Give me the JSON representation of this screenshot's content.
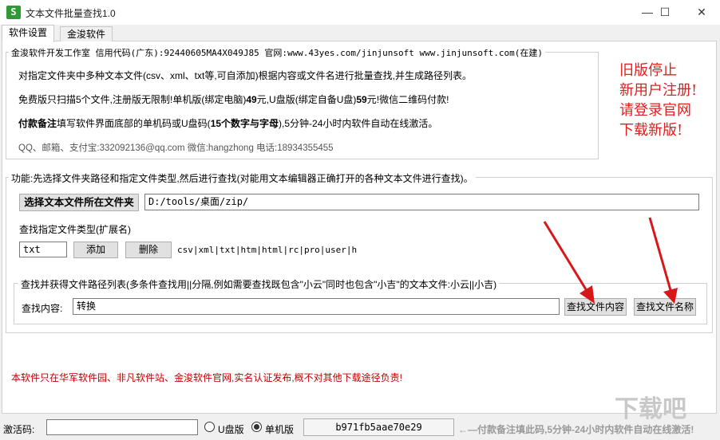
{
  "window": {
    "title": "文本文件批量查找1.0",
    "icon_glyph": "S",
    "minimize_glyph": "—",
    "maximize_glyph": "☐",
    "close_glyph": "✕"
  },
  "tabs": [
    {
      "label": "软件设置",
      "active": true
    },
    {
      "label": "金浚软件",
      "active": false
    }
  ],
  "info_group": {
    "legend": "金浚软件开发工作室 信用代码(广东):92440605MA4X049J85 官网:www.43yes.com/jinjunsoft  www.jinjunsoft.com(在建)",
    "line1": "对指定文件夹中多种文本文件(csv、xml、txt等,可自添加)根据内容或文件名进行批量查找,并生成路径列表。",
    "line2_a": "免费版只扫描5个文件,注册版无限制!单机版(绑定电脑)",
    "line2_b": "49",
    "line2_c": "元,U盘版(绑定自备U盘)",
    "line2_d": "59",
    "line2_e": "元!微信二维码付款!",
    "line3_a": "付款备注",
    "line3_b": "填写软件界面底部的单机码或U盘码(",
    "line3_c": "15个数字与字母",
    "line3_d": "),5分钟-24小时内软件自动在线激活。",
    "contact": "QQ、邮箱、支付宝:332092136@qq.com    微信:hangzhong    电话:18934355455"
  },
  "promo": {
    "line1": "旧版停止",
    "line2": "新用户注册!",
    "line3": "请登录官网",
    "line4": "下载新版!"
  },
  "function_group": {
    "legend": "功能:先选择文件夹路径和指定文件类型,然后进行查找(对能用文本编辑器正确打开的各种文本文件进行查找)。",
    "select_folder_button": "选择文本文件所在文件夹",
    "folder_path": "D:/tools/桌面/zip/",
    "file_type_label": "查找指定文件类型(扩展名)",
    "ext_input": "txt",
    "add_button": "添加",
    "delete_button": "删除",
    "ext_list": "csv|xml|txt|htm|html|rc|pro|user|h"
  },
  "search_group": {
    "legend": "查找并获得文件路径列表(多条件查找用||分隔,例如需要查找既包含\"小云\"同时也包含\"小吉\"的文本文件:小云||小吉)",
    "content_label": "查找内容:",
    "content_value": "转换",
    "find_content_button": "查找文件内容",
    "find_name_button": "查找文件名称"
  },
  "disclaimer": "本软件只在华军软件园、非凡软件站、金浚软件官网,实名认证发布,概不对其他下载途径负责!",
  "bottom_bar": {
    "activation_label": "激活码:",
    "activation_value": "",
    "usb_option": "U盘版",
    "standalone_option": "单机版",
    "usb_selected": false,
    "standalone_selected": true,
    "machine_code": "b971fb5aae70e29",
    "hint": "←—付款备注填此码,5分钟-24小时内软件自动在线激活!"
  },
  "watermark": "下载吧",
  "accent_colors": {
    "promo_red": "#e02020",
    "arrow_red": "#d81818",
    "disclaimer_red": "#c00000",
    "icon_green": "#2e9a35"
  }
}
